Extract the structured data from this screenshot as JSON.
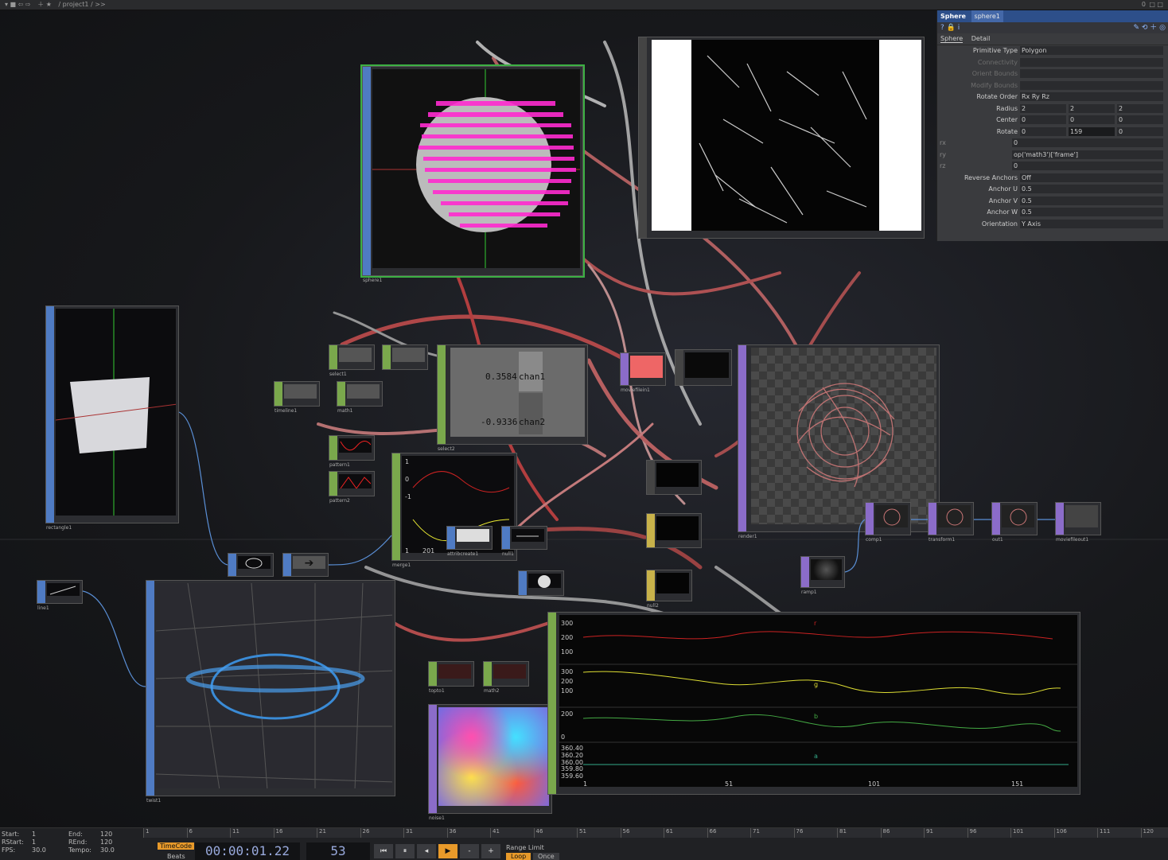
{
  "toolbar": {
    "path": "/ project1 / >>",
    "right_count": "0"
  },
  "params": {
    "type": "Sphere",
    "name": "sphere1",
    "tabs": [
      "Sphere",
      "Detail"
    ],
    "rows": [
      {
        "label": "Primitive Type",
        "v1": "Polygon"
      },
      {
        "label": "Connectivity",
        "v1": ""
      },
      {
        "label": "Orient Bounds",
        "v1": ""
      },
      {
        "label": "Modify Bounds",
        "v1": ""
      },
      {
        "label": "Rotate Order",
        "v1": "Rx Ry Rz"
      },
      {
        "label": "Radius",
        "v1": "2",
        "v2": "2",
        "v3": "2"
      },
      {
        "label": "Center",
        "v1": "0",
        "v2": "0",
        "v3": "0"
      },
      {
        "label": "Rotate",
        "v1": "0",
        "v2": "159",
        "v3": "0"
      },
      {
        "label": "rx",
        "v1": "0"
      },
      {
        "label": "ry",
        "v1": "op('math3')['frame']"
      },
      {
        "label": "rz",
        "v1": "0"
      },
      {
        "label": "Reverse Anchors",
        "v1": "Off"
      },
      {
        "label": "Anchor U",
        "v1": "0.5"
      },
      {
        "label": "Anchor V",
        "v1": "0.5"
      },
      {
        "label": "Anchor W",
        "v1": "0.5"
      },
      {
        "label": "Orientation",
        "v1": "Y Axis"
      }
    ]
  },
  "nodes": {
    "sphere1": "sphere1",
    "rectangle1": "rectangle1",
    "line1": "line1",
    "twist1": "twist1",
    "select1": "select1",
    "math1": "math1",
    "timeline1": "timeline1",
    "pattern1": "pattern1",
    "pattern2": "pattern2",
    "merge1": "merge1",
    "select2": "select2",
    "attribcreate1": "attribcreate1",
    "null1": "null1",
    "topto1": "topto1",
    "math2": "math2",
    "noise1": "noise1",
    "moviefilein1": "moviefilein1",
    "render1": "render1",
    "comp1": "comp1",
    "transform1": "transform1",
    "out1": "out1",
    "moviefileout1": "moviefileout1",
    "ramp1": "ramp1",
    "null2": "null2"
  },
  "chop_values": {
    "chan1_value": "0.3584",
    "chan1_name": "chan1",
    "chan2_value": "-0.9336",
    "chan2_name": "chan2"
  },
  "merge_graph": {
    "y_top": "1",
    "y_mid": "0",
    "y_low": "-1",
    "x_left": "1",
    "x_right": "201"
  },
  "bottom_graph": {
    "r_ticks": [
      "300",
      "200",
      "100"
    ],
    "g_ticks": [
      "300",
      "200",
      "100"
    ],
    "b_ticks": [
      "200",
      "0"
    ],
    "a_ticks": [
      "360.40",
      "360.20",
      "360.00",
      "359.80",
      "359.60"
    ],
    "x_ticks": [
      "1",
      "51",
      "101",
      "151"
    ],
    "labels": [
      "r",
      "g",
      "b",
      "a"
    ]
  },
  "time": {
    "start": "1",
    "end": "120",
    "rstart": "1",
    "rend": "120",
    "fps": "30.0",
    "tempo": "30.0",
    "start_lbl": "Start:",
    "end_lbl": "End:",
    "rstart_lbl": "RStart:",
    "rend_lbl": "REnd:",
    "fps_lbl": "FPS:",
    "tempo_lbl": "Tempo:",
    "timecode_mode": "TimeCode",
    "beats": "Beats",
    "timecode": "00:00:01.22",
    "frame": "53",
    "range_limit": "Range Limit",
    "loop": "Loop",
    "once": "Once",
    "ticks": [
      "1",
      "6",
      "11",
      "16",
      "21",
      "26",
      "31",
      "36",
      "41",
      "46",
      "51",
      "56",
      "61",
      "66",
      "71",
      "76",
      "81",
      "86",
      "91",
      "96",
      "101",
      "106",
      "111",
      "120"
    ]
  }
}
